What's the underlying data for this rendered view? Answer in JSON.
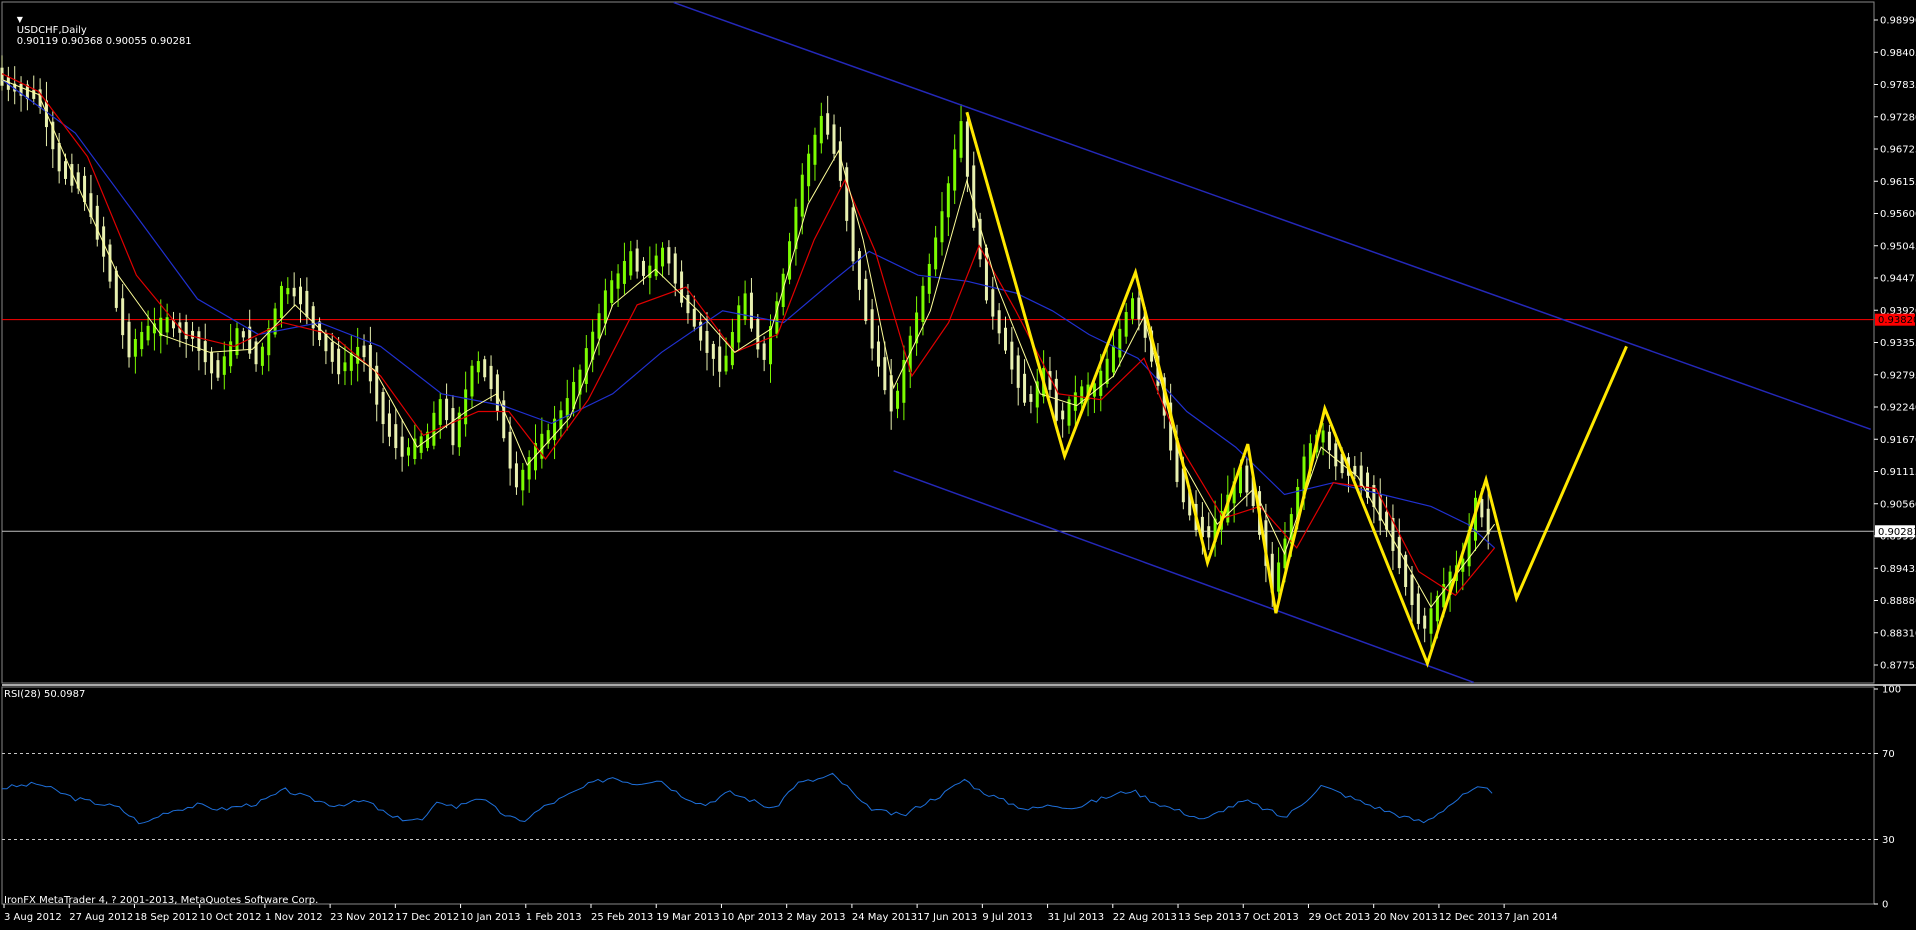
{
  "header": {
    "symbol": "USDCHF,Daily",
    "ohlc": "0.90119 0.90368 0.90055 0.90281"
  },
  "rsi_panel": {
    "label": "RSI(28) 50.0987",
    "levels": [
      30,
      70
    ],
    "axis_ticks": [
      "100",
      "70",
      "30",
      "0"
    ]
  },
  "copyright": "IronFX MetaTrader 4, ? 2001-2013, MetaQuotes Software Corp.",
  "colors": {
    "background": "#000000",
    "bullish_candle": "#7CFC00",
    "bearish_candle": "#E8F0B0",
    "ma_fast": "#FFFF99",
    "ma_medium": "#E00000",
    "ma_slow": "#2030D0",
    "channel": "#2428B8",
    "pattern": "#FFE800",
    "hline_resistance": "#FF0000",
    "hline_price": "#C0C0C0",
    "rsi_line": "#1E6FD9",
    "axis_text": "#FFFFFF"
  },
  "chart_data": {
    "type": "candlestick",
    "instrument": "USDCHF",
    "timeframe": "Daily",
    "x_tick_labels": [
      "3 Aug 2012",
      "27 Aug 2012",
      "18 Sep 2012",
      "10 Oct 2012",
      "1 Nov 2012",
      "23 Nov 2012",
      "17 Dec 2012",
      "10 Jan 2013",
      "1 Feb 2013",
      "25 Feb 2013",
      "19 Mar 2013",
      "10 Apr 2013",
      "2 May 2013",
      "24 May 2013",
      "17 Jun 2013",
      "9 Jul 2013",
      "31 Jul 2013",
      "22 Aug 2013",
      "13 Sep 2013",
      "7 Oct 2013",
      "29 Oct 2013",
      "20 Nov 2013",
      "12 Dec 2013",
      "7 Jan 2014"
    ],
    "y_tick_labels": [
      "0.98990",
      "0.98405",
      "0.97835",
      "0.97280",
      "0.96725",
      "0.96155",
      "0.95600",
      "0.95045",
      "0.94475",
      "0.93920",
      "0.93355",
      "0.92795",
      "0.92240",
      "0.91670",
      "0.91115",
      "0.90560",
      "0.89990",
      "0.89435",
      "0.88880",
      "0.88310",
      "0.87755"
    ],
    "ylim": [
      0.8772,
      0.9921
    ],
    "price_path": [
      [
        0,
        0.98
      ],
      [
        8,
        0.978
      ],
      [
        20,
        0.977
      ],
      [
        35,
        0.976
      ],
      [
        52,
        0.964
      ],
      [
        70,
        0.961
      ],
      [
        90,
        0.949
      ],
      [
        108,
        0.933
      ],
      [
        125,
        0.937
      ],
      [
        140,
        0.938
      ],
      [
        162,
        0.9355
      ],
      [
        180,
        0.929
      ],
      [
        200,
        0.937
      ],
      [
        215,
        0.931
      ],
      [
        235,
        0.944
      ],
      [
        250,
        0.942
      ],
      [
        265,
        0.9355
      ],
      [
        282,
        0.93
      ],
      [
        300,
        0.934
      ],
      [
        318,
        0.921
      ],
      [
        333,
        0.916
      ],
      [
        353,
        0.9185
      ],
      [
        365,
        0.925
      ],
      [
        375,
        0.918
      ],
      [
        392,
        0.932
      ],
      [
        408,
        0.927
      ],
      [
        425,
        0.91
      ],
      [
        443,
        0.917
      ],
      [
        460,
        0.9215
      ],
      [
        478,
        0.929
      ],
      [
        500,
        0.943
      ],
      [
        520,
        0.949
      ],
      [
        532,
        0.946
      ],
      [
        548,
        0.9505
      ],
      [
        562,
        0.942
      ],
      [
        578,
        0.935
      ],
      [
        596,
        0.93
      ],
      [
        612,
        0.943
      ],
      [
        628,
        0.931
      ],
      [
        645,
        0.946
      ],
      [
        660,
        0.962
      ],
      [
        677,
        0.973
      ],
      [
        690,
        0.965
      ],
      [
        703,
        0.948
      ],
      [
        718,
        0.934
      ],
      [
        735,
        0.923
      ],
      [
        748,
        0.9345
      ],
      [
        765,
        0.948
      ],
      [
        780,
        0.961
      ],
      [
        790,
        0.972
      ],
      [
        800,
        0.956
      ],
      [
        812,
        0.942
      ],
      [
        828,
        0.933
      ],
      [
        845,
        0.924
      ],
      [
        860,
        0.93
      ],
      [
        870,
        0.921
      ],
      [
        885,
        0.926
      ],
      [
        900,
        0.927
      ],
      [
        915,
        0.933
      ],
      [
        930,
        0.942
      ],
      [
        940,
        0.937
      ],
      [
        955,
        0.925
      ],
      [
        968,
        0.911
      ],
      [
        982,
        0.904
      ],
      [
        992,
        0.902
      ],
      [
        1005,
        0.906
      ],
      [
        1018,
        0.913
      ],
      [
        1030,
        0.908
      ],
      [
        1045,
        0.893
      ],
      [
        1058,
        0.903
      ],
      [
        1072,
        0.915
      ],
      [
        1085,
        0.92
      ],
      [
        1098,
        0.914
      ],
      [
        1112,
        0.913
      ],
      [
        1125,
        0.909
      ],
      [
        1140,
        0.903
      ],
      [
        1155,
        0.894
      ],
      [
        1168,
        0.886
      ],
      [
        1178,
        0.89
      ],
      [
        1190,
        0.895
      ],
      [
        1202,
        0.898
      ],
      [
        1212,
        0.908
      ],
      [
        1222,
        0.903
      ]
    ],
    "ma_fast": [
      [
        0,
        0.979
      ],
      [
        30,
        0.9765
      ],
      [
        60,
        0.962
      ],
      [
        95,
        0.946
      ],
      [
        130,
        0.936
      ],
      [
        170,
        0.933
      ],
      [
        205,
        0.9335
      ],
      [
        240,
        0.941
      ],
      [
        270,
        0.935
      ],
      [
        305,
        0.93
      ],
      [
        340,
        0.917
      ],
      [
        380,
        0.923
      ],
      [
        405,
        0.926
      ],
      [
        430,
        0.914
      ],
      [
        465,
        0.922
      ],
      [
        500,
        0.941
      ],
      [
        535,
        0.947
      ],
      [
        570,
        0.94
      ],
      [
        600,
        0.933
      ],
      [
        630,
        0.937
      ],
      [
        660,
        0.958
      ],
      [
        685,
        0.967
      ],
      [
        705,
        0.952
      ],
      [
        730,
        0.927
      ],
      [
        760,
        0.94
      ],
      [
        790,
        0.962
      ],
      [
        815,
        0.944
      ],
      [
        850,
        0.926
      ],
      [
        880,
        0.924
      ],
      [
        910,
        0.929
      ],
      [
        935,
        0.939
      ],
      [
        965,
        0.915
      ],
      [
        995,
        0.904
      ],
      [
        1025,
        0.91
      ],
      [
        1050,
        0.899
      ],
      [
        1080,
        0.917
      ],
      [
        1110,
        0.912
      ],
      [
        1140,
        0.901
      ],
      [
        1170,
        0.89
      ],
      [
        1200,
        0.898
      ],
      [
        1222,
        0.904
      ]
    ],
    "ma_medium": [
      [
        0,
        0.98
      ],
      [
        30,
        0.977
      ],
      [
        70,
        0.966
      ],
      [
        110,
        0.946
      ],
      [
        150,
        0.936
      ],
      [
        190,
        0.934
      ],
      [
        230,
        0.938
      ],
      [
        270,
        0.936
      ],
      [
        310,
        0.929
      ],
      [
        345,
        0.919
      ],
      [
        390,
        0.923
      ],
      [
        415,
        0.923
      ],
      [
        445,
        0.915
      ],
      [
        480,
        0.925
      ],
      [
        520,
        0.941
      ],
      [
        560,
        0.944
      ],
      [
        600,
        0.933
      ],
      [
        635,
        0.936
      ],
      [
        665,
        0.952
      ],
      [
        690,
        0.962
      ],
      [
        715,
        0.95
      ],
      [
        745,
        0.929
      ],
      [
        775,
        0.938
      ],
      [
        800,
        0.951
      ],
      [
        830,
        0.94
      ],
      [
        865,
        0.926
      ],
      [
        900,
        0.925
      ],
      [
        935,
        0.932
      ],
      [
        965,
        0.917
      ],
      [
        1000,
        0.905
      ],
      [
        1030,
        0.907
      ],
      [
        1060,
        0.9
      ],
      [
        1090,
        0.911
      ],
      [
        1125,
        0.91
      ],
      [
        1160,
        0.896
      ],
      [
        1190,
        0.892
      ],
      [
        1222,
        0.9
      ]
    ],
    "ma_slow": [
      [
        0,
        0.979
      ],
      [
        60,
        0.97
      ],
      [
        110,
        0.956
      ],
      [
        160,
        0.942
      ],
      [
        210,
        0.936
      ],
      [
        260,
        0.938
      ],
      [
        310,
        0.934
      ],
      [
        360,
        0.926
      ],
      [
        410,
        0.924
      ],
      [
        450,
        0.921
      ],
      [
        500,
        0.926
      ],
      [
        540,
        0.933
      ],
      [
        590,
        0.94
      ],
      [
        640,
        0.938
      ],
      [
        680,
        0.945
      ],
      [
        710,
        0.95
      ],
      [
        750,
        0.946
      ],
      [
        790,
        0.945
      ],
      [
        830,
        0.943
      ],
      [
        860,
        0.94
      ],
      [
        890,
        0.936
      ],
      [
        930,
        0.932
      ],
      [
        970,
        0.923
      ],
      [
        1010,
        0.917
      ],
      [
        1050,
        0.909
      ],
      [
        1090,
        0.911
      ],
      [
        1130,
        0.909
      ],
      [
        1170,
        0.907
      ],
      [
        1200,
        0.904
      ],
      [
        1222,
        0.9
      ]
    ],
    "rsi_path": [
      [
        0,
        54
      ],
      [
        30,
        56
      ],
      [
        60,
        49
      ],
      [
        95,
        45
      ],
      [
        115,
        37
      ],
      [
        135,
        43
      ],
      [
        160,
        46
      ],
      [
        180,
        44
      ],
      [
        210,
        47
      ],
      [
        232,
        53
      ],
      [
        252,
        49
      ],
      [
        272,
        46
      ],
      [
        298,
        48
      ],
      [
        320,
        40
      ],
      [
        345,
        39
      ],
      [
        358,
        48
      ],
      [
        372,
        45
      ],
      [
        390,
        50
      ],
      [
        410,
        42
      ],
      [
        425,
        38
      ],
      [
        443,
        45
      ],
      [
        465,
        51
      ],
      [
        482,
        56
      ],
      [
        500,
        59
      ],
      [
        518,
        56
      ],
      [
        538,
        58
      ],
      [
        555,
        51
      ],
      [
        575,
        46
      ],
      [
        595,
        52
      ],
      [
        615,
        48
      ],
      [
        632,
        44
      ],
      [
        650,
        56
      ],
      [
        668,
        58
      ],
      [
        680,
        60
      ],
      [
        693,
        54
      ],
      [
        705,
        46
      ],
      [
        720,
        43
      ],
      [
        738,
        41
      ],
      [
        752,
        46
      ],
      [
        770,
        51
      ],
      [
        788,
        58
      ],
      [
        800,
        53
      ],
      [
        820,
        48
      ],
      [
        840,
        44
      ],
      [
        860,
        46
      ],
      [
        880,
        45
      ],
      [
        900,
        49
      ],
      [
        925,
        53
      ],
      [
        945,
        47
      ],
      [
        965,
        43
      ],
      [
        985,
        39
      ],
      [
        1000,
        44
      ],
      [
        1018,
        48
      ],
      [
        1035,
        44
      ],
      [
        1050,
        40
      ],
      [
        1065,
        47
      ],
      [
        1080,
        55
      ],
      [
        1098,
        51
      ],
      [
        1115,
        47
      ],
      [
        1135,
        43
      ],
      [
        1150,
        40
      ],
      [
        1165,
        38
      ],
      [
        1180,
        44
      ],
      [
        1195,
        50
      ],
      [
        1210,
        54
      ],
      [
        1222,
        52
      ]
    ],
    "channel_lines": [
      {
        "from": [
          550,
          0.992
        ],
        "to": [
          1530,
          0.92
        ]
      },
      {
        "from": [
          730,
          0.913
        ],
        "to": [
          1205,
          0.8773
        ]
      }
    ],
    "pattern_path": [
      [
        790,
        0.9735
      ],
      [
        870,
        0.9155
      ],
      [
        928,
        0.9465
      ],
      [
        987,
        0.8975
      ],
      [
        1020,
        0.9175
      ],
      [
        1043,
        0.889
      ],
      [
        1083,
        0.9235
      ],
      [
        1167,
        0.8805
      ],
      [
        1215,
        0.9115
      ],
      [
        1240,
        0.8915
      ],
      [
        1330,
        0.934
      ]
    ],
    "hlines": [
      {
        "price": 0.9385,
        "label": "0.93820"
      },
      {
        "price": 0.9028,
        "label": "0.90281"
      }
    ]
  }
}
